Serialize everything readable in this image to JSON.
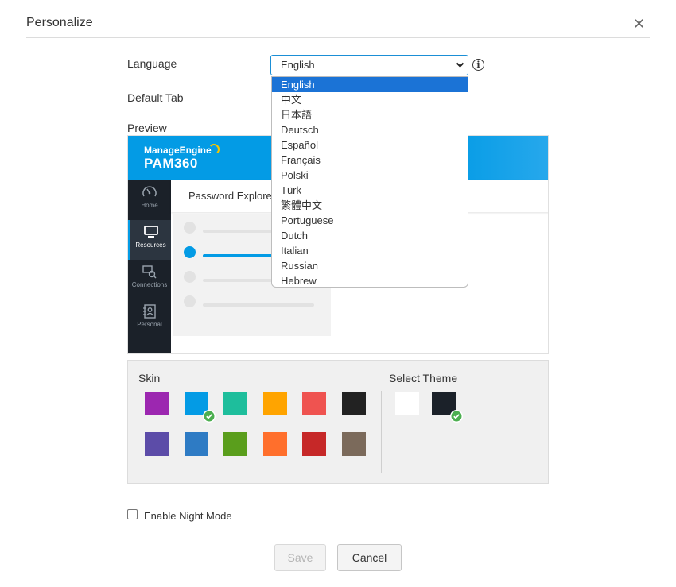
{
  "dialog": {
    "title": "Personalize"
  },
  "form": {
    "language_label": "Language",
    "language_value": "English",
    "default_tab_label": "Default Tab",
    "preview_label": "Preview"
  },
  "language_options": [
    "English",
    "中文",
    "日本語",
    "Deutsch",
    "Español",
    "Français",
    "Polski",
    "Türk",
    "繁體中文",
    "Portuguese",
    "Dutch",
    "Italian",
    "Russian",
    "Hebrew"
  ],
  "selected_language_index": 0,
  "preview": {
    "brand_top": "ManageEngine",
    "brand_product": "PAM360",
    "tab_label": "Password Explore",
    "nav": [
      {
        "label": "Home",
        "icon": "gauge-icon"
      },
      {
        "label": "Resources",
        "icon": "monitor-icon"
      },
      {
        "label": "Connections",
        "icon": "connections-icon"
      },
      {
        "label": "Personal",
        "icon": "contact-book-icon"
      }
    ],
    "active_nav_index": 1
  },
  "skin": {
    "label": "Skin",
    "colors": [
      "#9c27b0",
      "#039be5",
      "#1ebe9c",
      "#ffa400",
      "#ef5350",
      "#222222",
      "#5c4ca8",
      "#2e7bc4",
      "#5a9e1c",
      "#ff6f2c",
      "#c62828",
      "#7b6a5b"
    ],
    "selected_index": 1
  },
  "theme": {
    "label": "Select Theme",
    "colors": [
      "#ffffff",
      "#1b2129"
    ],
    "selected_index": 1
  },
  "night_mode": {
    "label": "Enable Night Mode",
    "checked": false
  },
  "buttons": {
    "save": "Save",
    "cancel": "Cancel"
  }
}
